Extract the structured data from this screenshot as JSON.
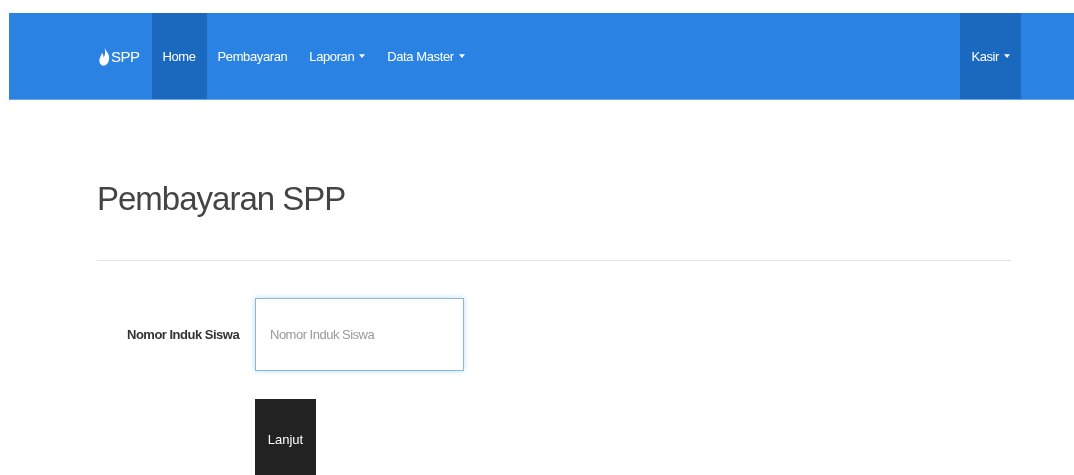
{
  "navbar": {
    "brand": "SPP",
    "items": [
      {
        "label": "Home",
        "selected": true,
        "dropdown": false
      },
      {
        "label": "Pembayaran",
        "selected": false,
        "dropdown": false
      },
      {
        "label": "Laporan",
        "selected": false,
        "dropdown": true
      },
      {
        "label": "Data Master",
        "selected": false,
        "dropdown": true
      }
    ],
    "user_menu": {
      "label": "Kasir",
      "selected": true,
      "dropdown": true
    }
  },
  "page_title": "Pembayaran SPP",
  "form": {
    "label": "Nomor Induk Siswa",
    "placeholder": "Nomor Induk Siswa",
    "button": "Lanjut"
  }
}
